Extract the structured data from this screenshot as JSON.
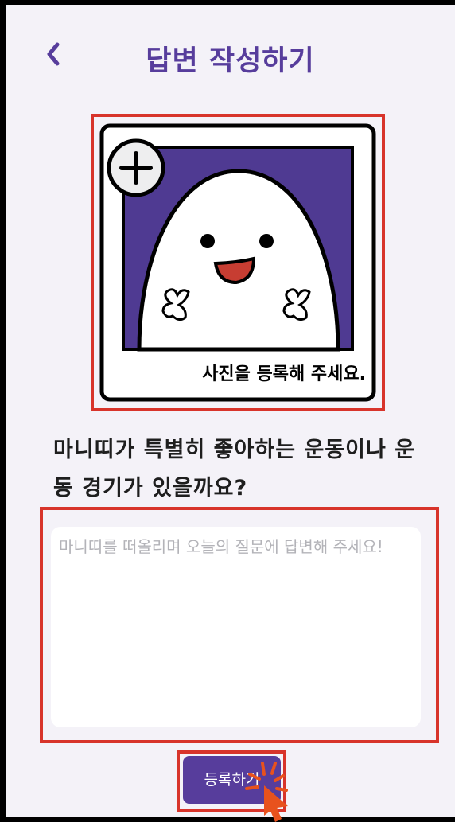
{
  "header": {
    "title": "답변 작성하기",
    "back_icon": "chevron-left-icon"
  },
  "photo": {
    "caption": "사진을 등록해 주세요.",
    "add_icon": "plus-circle-icon",
    "illustration": "white ghost character on purple background"
  },
  "question": {
    "text": "마니띠가 특별히 좋아하는 운동이나 운동 경기가 있을까요?"
  },
  "answer": {
    "placeholder": "마니띠를 떠올리며 오늘의 질문에 답변해 주세요!",
    "value": ""
  },
  "submit": {
    "label": "등록하기"
  },
  "colors": {
    "accent": "#573d9c",
    "highlight": "#d8342b",
    "background": "#f4f2f8"
  }
}
